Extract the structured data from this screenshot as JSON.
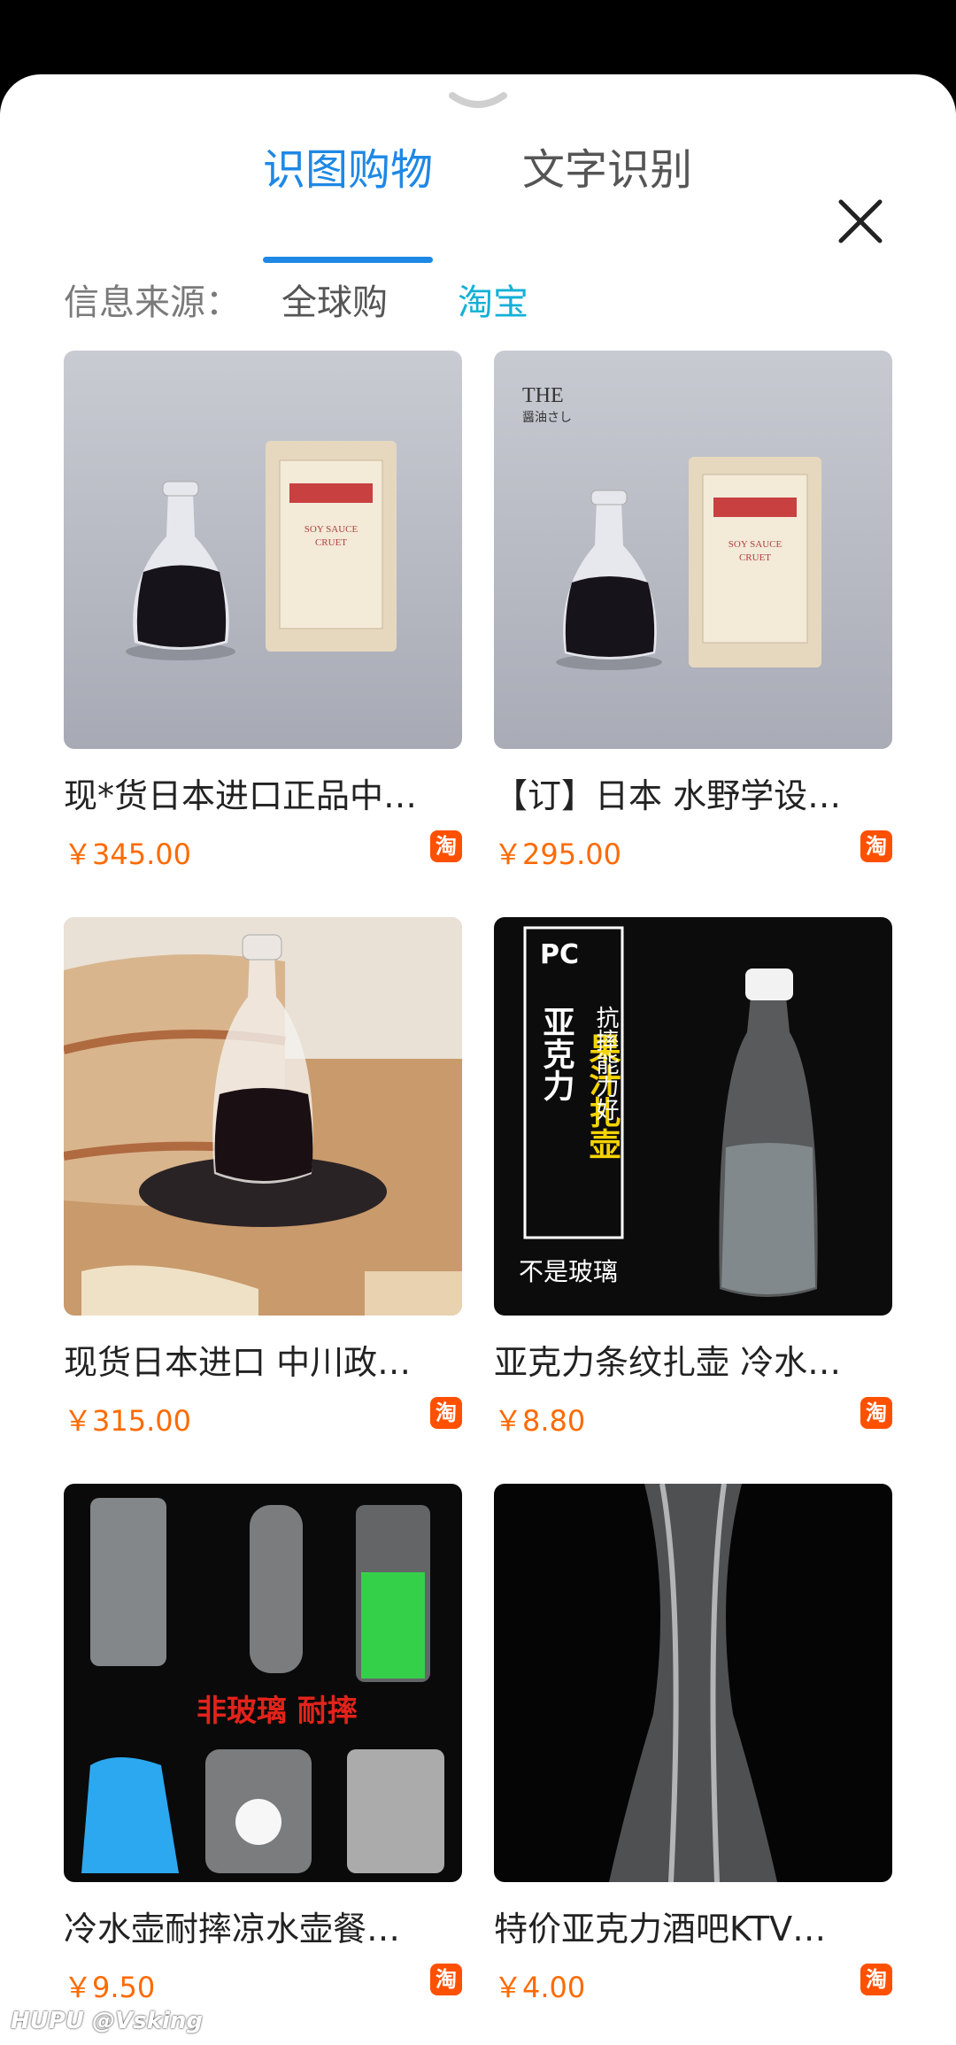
{
  "tabs": [
    {
      "label": "识图购物",
      "active": true
    },
    {
      "label": "文字识别",
      "active": false
    }
  ],
  "source": {
    "label": "信息来源：",
    "options": [
      {
        "label": "全球购",
        "selected": false
      },
      {
        "label": "淘宝",
        "selected": true
      }
    ]
  },
  "products": [
    {
      "title": "现*货日本进口正品中…",
      "price": "￥345.00",
      "badge": "淘"
    },
    {
      "title": "【订】日本 水野学设…",
      "price": "￥295.00",
      "badge": "淘"
    },
    {
      "title": "现货日本进口 中川政…",
      "price": "￥315.00",
      "badge": "淘"
    },
    {
      "title": "亚克力条纹扎壶 冷水…",
      "price": "￥8.80",
      "badge": "淘"
    },
    {
      "title": "冷水壶耐摔凉水壶餐…",
      "price": "￥9.50",
      "badge": "淘"
    },
    {
      "title": "特价亚克力酒吧KTV…",
      "price": "￥4.00",
      "badge": "淘"
    }
  ],
  "thumb_text": {
    "box_label_1": "SOY SAUCE",
    "box_label_2": "CRUET",
    "the_label": "THE",
    "the_sub": "醤油さし",
    "pc_label": "PC",
    "pc_title_1": "亚克力",
    "pc_title_2": "果汁扎壶",
    "pc_side": "抗摔能力好",
    "pc_note": "不是玻璃",
    "jugs_text": "非玻璃 耐摔"
  },
  "watermark": "HUPU @Vsking",
  "colors": {
    "accent": "#1e88e5",
    "source_selected": "#13b0d6",
    "price": "#ff6a00",
    "taobao_badge": "#ff5000"
  },
  "icons": [
    "chevron-down-icon",
    "close-icon",
    "taobao-icon"
  ]
}
